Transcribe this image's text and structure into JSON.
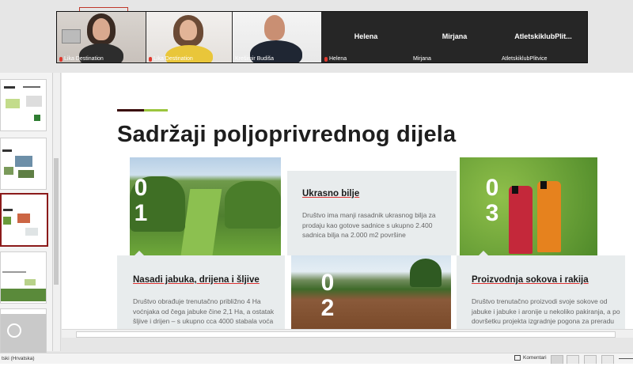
{
  "zoom": {
    "participants": [
      {
        "name": "Lika Destination",
        "muted": true
      },
      {
        "name": "Lika Destination",
        "muted": true
      },
      {
        "name": "Krešimir Budiša",
        "muted": false
      },
      {
        "name": "Helena",
        "muted": true,
        "center_label": "Helena"
      },
      {
        "name": "Mirjana",
        "muted": false,
        "center_label": "Mirjana"
      },
      {
        "name": "AtletskiklubPlitvice",
        "muted": false,
        "center_label": "AtletskiklubPlit..."
      }
    ]
  },
  "slide": {
    "title": "Sadržaji poljoprivrednog dijela",
    "accent_colors": {
      "dark": "#3a0a0a",
      "green": "#9bc53d"
    },
    "numbers": {
      "n1": "0\n1",
      "n2": "0\n2",
      "n3": "0\n3"
    },
    "card_ukrasno": {
      "heading": "Ukrasno bilje",
      "text": "Društvo ima manji rasadnik ukrasnog bilja za prodaju kao gotove sadnice s ukupno 2.400 sadnica bilja na 2.000 m2 površine"
    },
    "card_nasadi": {
      "heading": "Nasadi jabuka, drijena i šljive",
      "text": "Društvo obrađuje trenutačno  približno 4 Ha voćnjaka od čega jabuke čine 2,1 Ha, a ostatak šljive i drijen – s ukupno cca 4000 stabala voća"
    },
    "card_sokovi": {
      "heading": "Proizvodnja sokova i rakija",
      "text": "Društvo trenutačno proizvodi svoje sokove od jabuke i jabuke i aronije u nekoliko pakiranja, a po dovršetku projekta izgradnje pogona za preradu planirano je više vrsta"
    }
  },
  "status": {
    "language": "tski (Hrvatska)",
    "comments_label": "Komentari"
  }
}
